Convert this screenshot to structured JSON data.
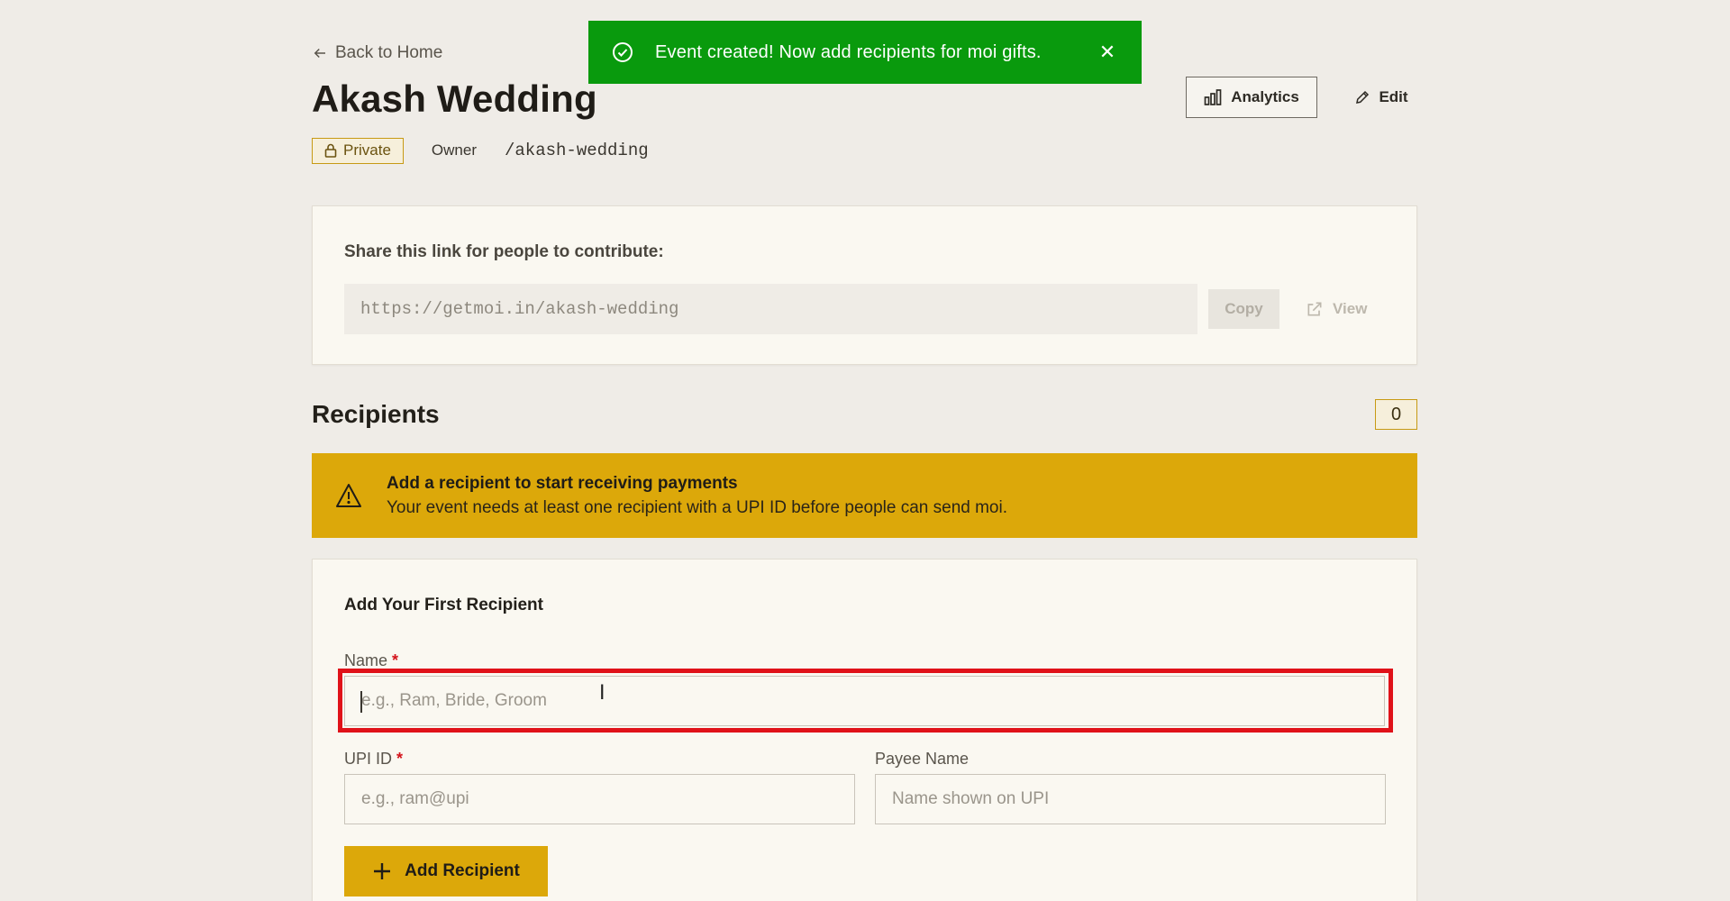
{
  "toast": {
    "message": "Event created! Now add recipients for moi gifts.",
    "close": "✕",
    "bg_color": "#099a0d"
  },
  "header": {
    "back_label": "Back to Home",
    "title": "Akash Wedding",
    "privacy_label": "Private",
    "role": "Owner",
    "slug": "/akash-wedding",
    "analytics_label": "Analytics",
    "edit_label": "Edit"
  },
  "share": {
    "label": "Share this link for people to contribute:",
    "url": "https://getmoi.in/akash-wedding",
    "copy_label": "Copy",
    "view_label": "View"
  },
  "recipients": {
    "title": "Recipients",
    "count": "0",
    "warning_title": "Add a recipient to start receiving payments",
    "warning_text": "Your event needs at least one recipient with a UPI ID before people can send moi.",
    "warning_color": "#dca80a"
  },
  "form": {
    "title": "Add Your First Recipient",
    "name_label": "Name",
    "name_placeholder": "e.g., Ram, Bride, Groom",
    "upi_label": "UPI ID",
    "upi_placeholder": "e.g., ram@upi",
    "payee_label": "Payee Name",
    "payee_placeholder": "Name shown on UPI",
    "required_mark": "*",
    "submit_label": "Add Recipient"
  },
  "icons": {
    "toast": "check-circle-icon",
    "back": "arrow-left-icon",
    "private": "lock-icon",
    "analytics": "bar-chart-icon",
    "edit": "pencil-icon",
    "view": "external-link-icon",
    "warning": "warning-triangle-icon",
    "add": "plus-icon"
  }
}
